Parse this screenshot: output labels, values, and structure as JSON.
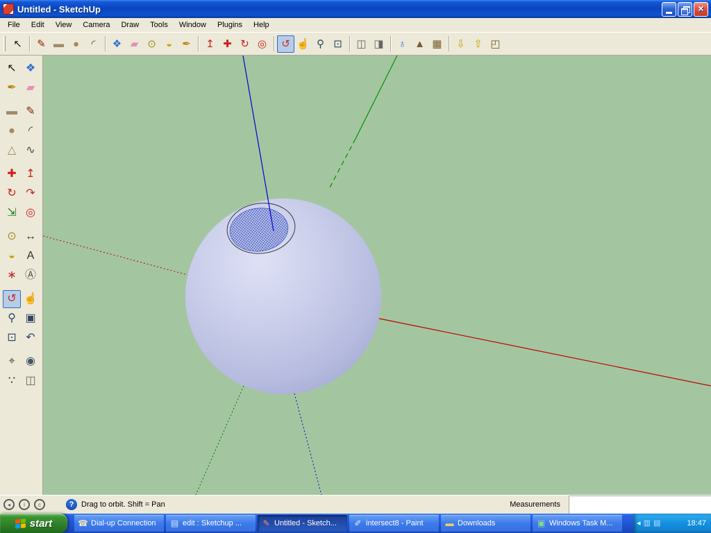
{
  "window": {
    "title": "Untitled - SketchUp",
    "controls": [
      "minimize-button",
      "restore-button",
      "close-button"
    ]
  },
  "menubar": {
    "items": [
      "File",
      "Edit",
      "View",
      "Camera",
      "Draw",
      "Tools",
      "Window",
      "Plugins",
      "Help"
    ]
  },
  "toolbar_top": {
    "groups": [
      [
        "select"
      ],
      [
        "line",
        "rectangle",
        "circle",
        "arc"
      ],
      [
        "make-component",
        "eraser",
        "tape-measure",
        "protractor",
        "paint-bucket"
      ],
      [
        "push-pull",
        "move",
        "rotate",
        "offset"
      ],
      [
        "orbit",
        "pan",
        "zoom",
        "zoom-extents"
      ],
      [
        "section-plane",
        "section-display"
      ],
      [
        "add-location",
        "toggle-terrain",
        "photo-textures"
      ],
      [
        "get-models",
        "share-model",
        "share-component"
      ]
    ],
    "active_tool": "orbit"
  },
  "tool_palette": {
    "rows": [
      [
        "select",
        "make-component"
      ],
      [
        "paint-bucket",
        "eraser"
      ],
      [
        "rectangle",
        "line"
      ],
      [
        "circle",
        "arc"
      ],
      [
        "polygon",
        "freehand"
      ],
      [
        "move",
        "push-pull"
      ],
      [
        "rotate",
        "follow-me"
      ],
      [
        "scale",
        "offset"
      ],
      [
        "tape-measure",
        "dimension"
      ],
      [
        "protractor",
        "text"
      ],
      [
        "axes",
        "3d-text"
      ],
      [
        "orbit",
        "pan"
      ],
      [
        "zoom",
        "zoom-window"
      ],
      [
        "zoom-extents",
        "previous"
      ],
      [
        "position-camera",
        "look-around"
      ],
      [
        "walk",
        "section-plane"
      ]
    ],
    "active_tool": "orbit",
    "group_breaks_after_rows": [
      1,
      4,
      7,
      10,
      13
    ]
  },
  "viewport": {
    "background_color": "#A3C6A0",
    "sphere_color": "#C6CAE8",
    "selection_color": "#1F3BB4",
    "axis_colors": {
      "red": "#C00000",
      "green": "#008000",
      "blue": "#0000D6"
    }
  },
  "statusbar": {
    "status_icons": [
      "status-circle-1",
      "status-circle-2",
      "status-circle-3"
    ],
    "help_glyph": "?",
    "help_hint": "Drag to orbit.  Shift = Pan",
    "measurements_label": "Measurements",
    "measurement_value": ""
  },
  "taskbar": {
    "start_label": "start",
    "tasks": [
      {
        "label": "Dial-up Connection",
        "icon": "dialup-icon",
        "active": false
      },
      {
        "label": "edit : Sketchup ...",
        "icon": "browser-icon",
        "active": false
      },
      {
        "label": "Untitled - Sketch...",
        "icon": "sketchup-icon",
        "active": true
      },
      {
        "label": "intersect8 - Paint",
        "icon": "paint-icon",
        "active": false
      },
      {
        "label": "Downloads",
        "icon": "folder-icon",
        "active": false
      },
      {
        "label": "Windows Task M...",
        "icon": "taskmanager-icon",
        "active": false
      }
    ],
    "tray": {
      "icons": [
        "tray-chevron-icon",
        "network-icon",
        "display-icon"
      ],
      "clock": "18:47"
    }
  }
}
